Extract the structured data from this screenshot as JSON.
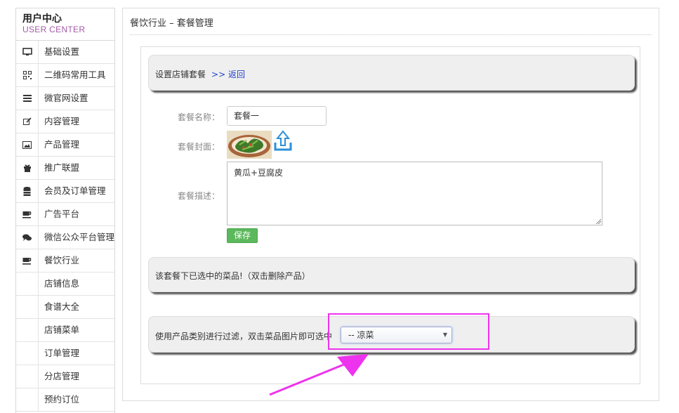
{
  "user_center": {
    "title": "用户中心",
    "subtitle": "USER CENTER"
  },
  "sidebar": {
    "items": [
      {
        "label": "基础设置",
        "icon": "monitor-icon"
      },
      {
        "label": "二维码常用工具",
        "icon": "qrcode-icon"
      },
      {
        "label": "微官网设置",
        "icon": "list-icon"
      },
      {
        "label": "内容管理",
        "icon": "edit-icon"
      },
      {
        "label": "产品管理",
        "icon": "picture-icon"
      },
      {
        "label": "推广联盟",
        "icon": "gift-icon"
      },
      {
        "label": "会员及订单管理",
        "icon": "database-icon"
      },
      {
        "label": "广告平台",
        "icon": "coffee-icon"
      },
      {
        "label": "微信公众平台管理",
        "icon": "comments-icon"
      },
      {
        "label": "餐饮行业",
        "icon": "coffee-icon"
      }
    ],
    "subitems": [
      {
        "label": "店铺信息"
      },
      {
        "label": "食谱大全"
      },
      {
        "label": "店铺菜单"
      },
      {
        "label": "订单管理"
      },
      {
        "label": "分店管理"
      },
      {
        "label": "预约订位"
      }
    ]
  },
  "main": {
    "title": "餐饮行业 – 套餐管理",
    "setup_bar": {
      "text": "设置店铺套餐",
      "back_link": ">> 返回"
    },
    "form": {
      "name_label": "套餐名称：",
      "name_value": "套餐一",
      "cover_label": "套餐封面：",
      "desc_label": "套餐描述：",
      "desc_value": "黄瓜+豆腐皮",
      "save_label": "保存"
    },
    "selected_bar": {
      "text": "该套餐下已选中的菜品!（双击删除产品）"
    },
    "filter_bar": {
      "text": "使用产品类别进行过滤，双击菜品图片即可选中",
      "select_value": "-- 凉菜"
    }
  },
  "colors": {
    "highlight": "#ee33ee",
    "save_button": "#5cb85c",
    "link": "#2244cc",
    "brand_sub": "#a35aa6"
  }
}
